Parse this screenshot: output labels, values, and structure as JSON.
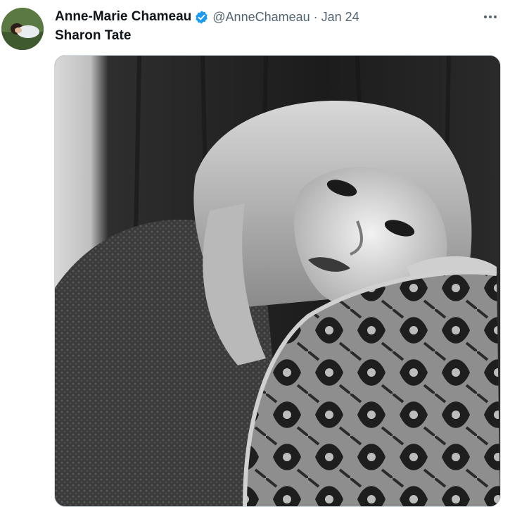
{
  "tweet": {
    "author_name": "Anne-Marie Chameau",
    "handle": "@AnneChameau",
    "separator": "·",
    "date": "Jan 24",
    "text": "Sharon Tate",
    "verified_color": "#1d9bf0"
  },
  "icons": {
    "avatar": "profile-photo",
    "verified": "verified-badge-icon",
    "more": "more-horizontal-icon"
  },
  "colors": {
    "text_primary": "#0f1419",
    "text_secondary": "#536471",
    "accent": "#1d9bf0"
  }
}
